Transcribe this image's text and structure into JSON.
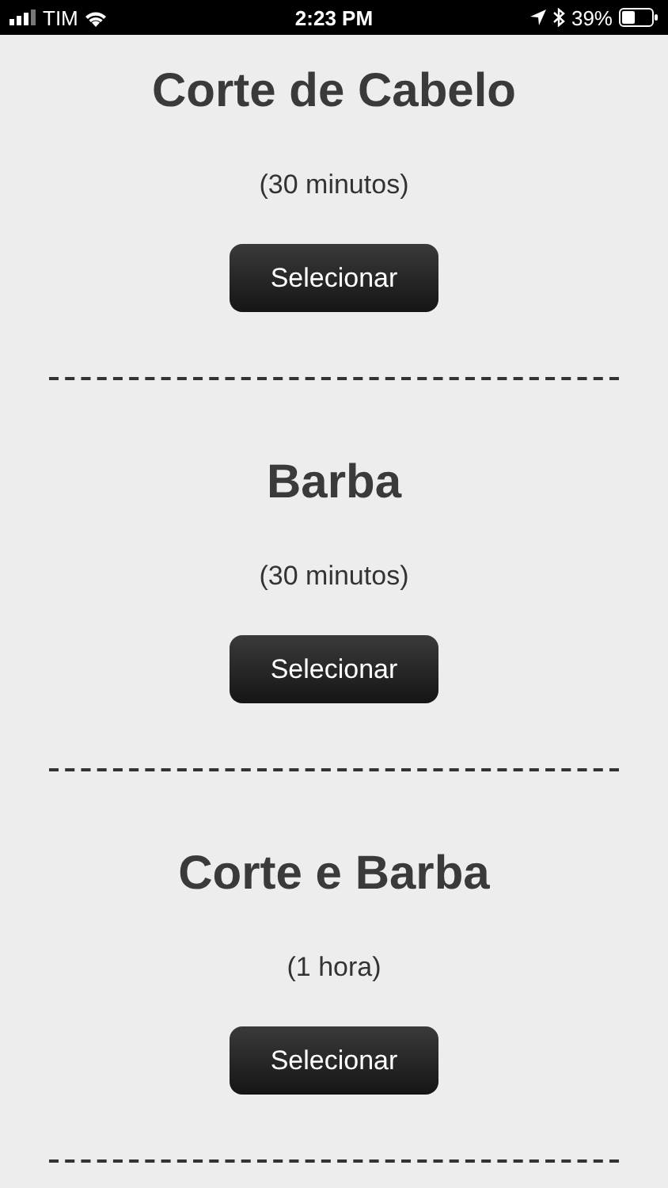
{
  "status_bar": {
    "carrier": "TIM",
    "time": "2:23 PM",
    "battery": "39%"
  },
  "services": [
    {
      "name": "Corte de Cabelo",
      "duration": "(30 minutos)",
      "button": "Selecionar"
    },
    {
      "name": "Barba",
      "duration": "(30 minutos)",
      "button": "Selecionar"
    },
    {
      "name": "Corte e Barba",
      "duration": "(1 hora)",
      "button": "Selecionar"
    }
  ]
}
